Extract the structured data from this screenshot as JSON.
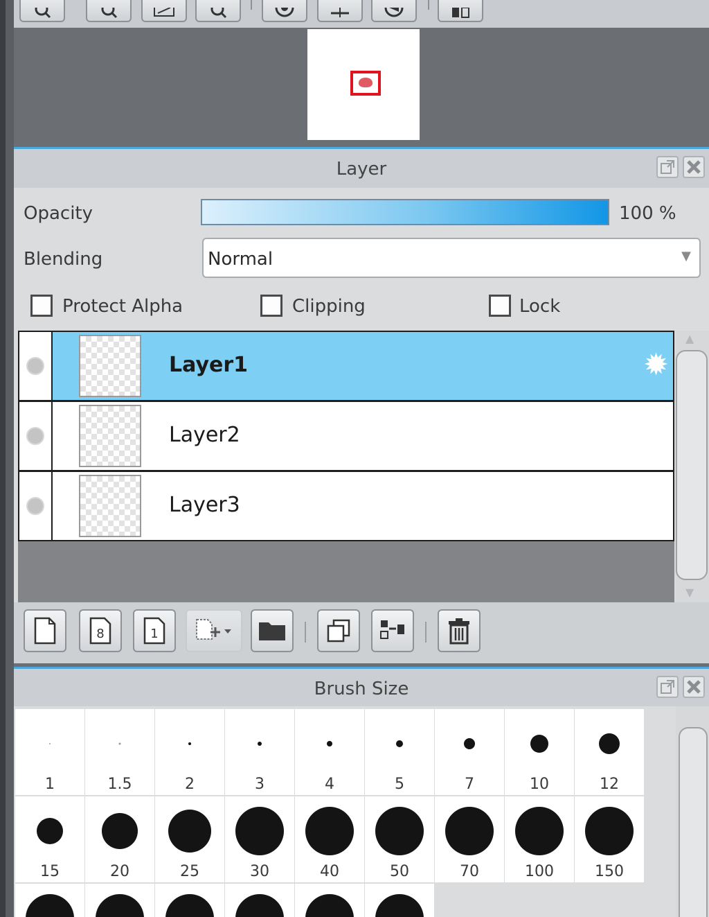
{
  "layer_panel": {
    "title": "Layer",
    "opacity_label": "Opacity",
    "opacity_value": "100 %",
    "opacity_fraction": 1.0,
    "blending_label": "Blending",
    "blending_value": "Normal",
    "protect_alpha_label": "Protect Alpha",
    "clipping_label": "Clipping",
    "lock_label": "Lock",
    "layers": [
      {
        "name": "Layer1",
        "selected": true
      },
      {
        "name": "Layer2",
        "selected": false
      },
      {
        "name": "Layer3",
        "selected": false
      }
    ],
    "accent_color": "#7ecff4"
  },
  "brush_panel": {
    "title": "Brush Size",
    "sizes": [
      "1",
      "1.5",
      "2",
      "3",
      "4",
      "5",
      "7",
      "10",
      "12",
      "15",
      "20",
      "25",
      "30",
      "40",
      "50",
      "70",
      "100",
      "150"
    ]
  },
  "icons": {
    "top_toolbar": [
      "zoom-in-icon",
      "zoom-out-icon",
      "fit-icon",
      "zoom-icon",
      "rotate-icon",
      "flip-icon",
      "reset-icon",
      "split-icon"
    ],
    "layer_toolbar": [
      "new-layer-icon",
      "new-8bit-layer-icon",
      "new-1bit-layer-icon",
      "add-layer-dropdown-icon",
      "folder-icon",
      "duplicate-icon",
      "merge-icon",
      "trash-icon"
    ]
  },
  "colors": {
    "panel_accent": "#4aa8dc",
    "selected_row": "#7ecff4",
    "navigator_frame": "#e0141e"
  }
}
